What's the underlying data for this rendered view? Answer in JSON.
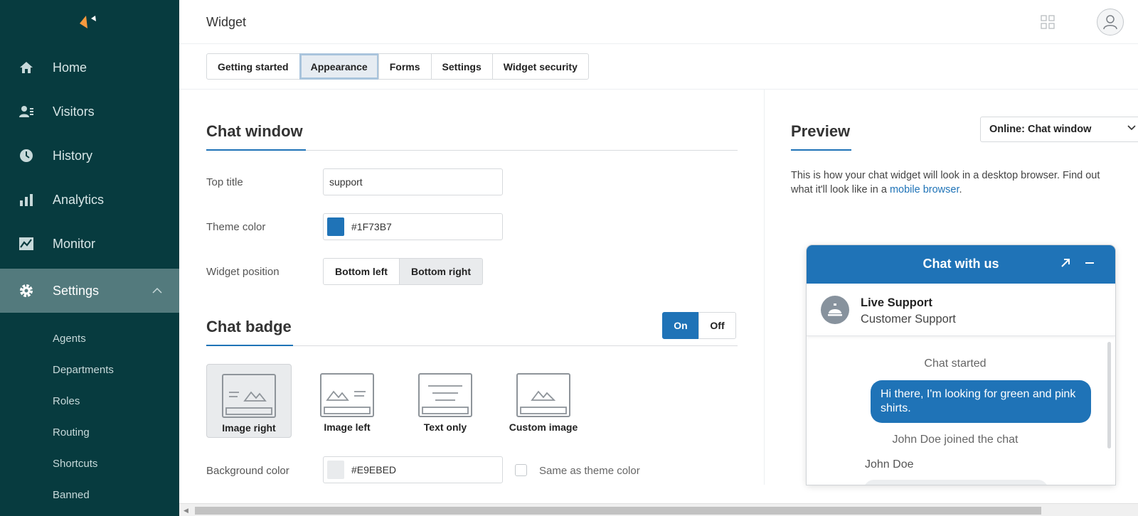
{
  "sidebar": {
    "nav": [
      {
        "label": "Home",
        "icon": "home-icon"
      },
      {
        "label": "Visitors",
        "icon": "visitors-icon"
      },
      {
        "label": "History",
        "icon": "clock-icon"
      },
      {
        "label": "Analytics",
        "icon": "bar-chart-icon"
      },
      {
        "label": "Monitor",
        "icon": "monitor-chart-icon"
      },
      {
        "label": "Settings",
        "icon": "gear-icon"
      }
    ],
    "sub": [
      "Agents",
      "Departments",
      "Roles",
      "Routing",
      "Shortcuts",
      "Banned"
    ]
  },
  "header": {
    "title": "Widget"
  },
  "tabs": [
    "Getting started",
    "Appearance",
    "Forms",
    "Settings",
    "Widget security"
  ],
  "chat_window": {
    "title": "Chat window",
    "top_title_label": "Top title",
    "top_title_value": "support",
    "theme_color_label": "Theme color",
    "theme_color_value": "#1F73B7",
    "widget_position_label": "Widget position",
    "position_options": [
      "Bottom left",
      "Bottom right"
    ]
  },
  "chat_badge": {
    "title": "Chat badge",
    "toggle": [
      "On",
      "Off"
    ],
    "options": [
      "Image right",
      "Image left",
      "Text only",
      "Custom image"
    ],
    "bg_color_label": "Background color",
    "bg_color_value": "#E9EBED",
    "same_as_theme_label": "Same as theme color"
  },
  "preview": {
    "title": "Preview",
    "select_value": "Online: Chat window",
    "desc_text": "This is how your chat widget will look in a desktop browser. Find out what it'll look like in a ",
    "desc_link": "mobile browser",
    "desc_end": "."
  },
  "widget": {
    "title": "Chat with us",
    "agent_name": "Live Support",
    "agent_role": "Customer Support",
    "chat_started": "Chat started",
    "message": "Hi there, I'm looking for green and pink shirts.",
    "joined": "John Doe joined the chat",
    "agent_label": "John Doe"
  },
  "colors": {
    "sidebar_bg": "#073b3f",
    "accent": "#1f73b7",
    "badge_bg": "#E9EBED"
  }
}
